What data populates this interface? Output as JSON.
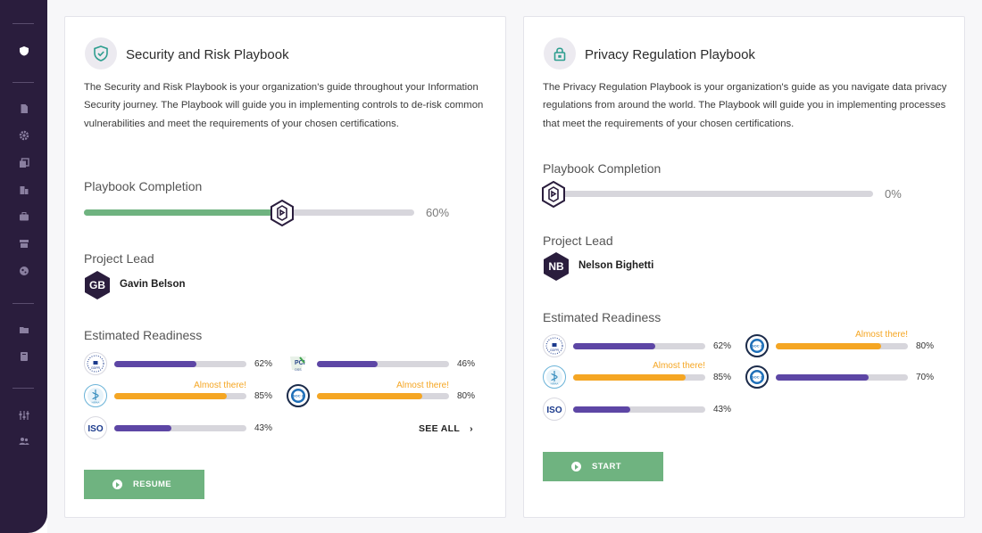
{
  "sidebar": {
    "icons": [
      "shield-icon",
      "document-icon",
      "gear-icon",
      "copy-icon",
      "building-icon",
      "briefcase-icon",
      "store-icon",
      "globe-icon",
      "folder-icon",
      "book-icon",
      "sliders-icon",
      "users-icon"
    ]
  },
  "colors": {
    "green": "#6fb380",
    "purple": "#5d46a5",
    "orange": "#f5a623",
    "track": "#d7d6dc",
    "sidebar": "#2a1d3d"
  },
  "cards": [
    {
      "title": "Security and Risk Playbook",
      "description": "The Security and Risk Playbook is your organization's guide throughout your Information Security journey. The Playbook will guide you in implementing controls to de-risk common vulnerabilities and meet the requirements of your chosen certifications.",
      "completion_label": "Playbook Completion",
      "completion": 0.6,
      "completion_text": "60%",
      "lead_label": "Project Lead",
      "lead": {
        "initials": "GB",
        "name": "Gavin Belson"
      },
      "readiness_label": "Estimated Readiness",
      "readiness": [
        {
          "badge": "GDPR",
          "value": 0.62,
          "pct": "62%",
          "color": "purple",
          "note": ""
        },
        {
          "badge": "PCI DSS",
          "value": 0.46,
          "pct": "46%",
          "color": "purple",
          "note": ""
        },
        {
          "badge": "HIPAA",
          "value": 0.85,
          "pct": "85%",
          "color": "orange",
          "note": "Almost there!"
        },
        {
          "badge": "SOC 2",
          "value": 0.8,
          "pct": "80%",
          "color": "orange",
          "note": "Almost there!"
        },
        {
          "badge": "ISO",
          "value": 0.43,
          "pct": "43%",
          "color": "purple",
          "note": ""
        }
      ],
      "see_all": "SEE ALL",
      "button": "RESUME"
    },
    {
      "title": "Privacy Regulation Playbook",
      "description": "The Privacy Regulation Playbook is your organization's guide as you navigate data privacy regulations from around the world. The Playbook will guide you in implementing processes that meet the requirements of your chosen certifications.",
      "completion_label": "Playbook Completion",
      "completion": 0.0,
      "completion_text": "0%",
      "lead_label": "Project Lead",
      "lead": {
        "initials": "NB",
        "name": "Nelson Bighetti"
      },
      "readiness_label": "Estimated Readiness",
      "readiness": [
        {
          "badge": "GDPR",
          "value": 0.62,
          "pct": "62%",
          "color": "purple",
          "note": ""
        },
        {
          "badge": "SOC 2",
          "value": 0.8,
          "pct": "80%",
          "color": "orange",
          "note": "Almost there!"
        },
        {
          "badge": "HIPAA",
          "value": 0.85,
          "pct": "85%",
          "color": "orange",
          "note": "Almost there!"
        },
        {
          "badge": "SOC 2",
          "value": 0.7,
          "pct": "70%",
          "color": "purple",
          "note": ""
        },
        {
          "badge": "ISO",
          "value": 0.43,
          "pct": "43%",
          "color": "purple",
          "note": ""
        }
      ],
      "button": "START"
    }
  ]
}
